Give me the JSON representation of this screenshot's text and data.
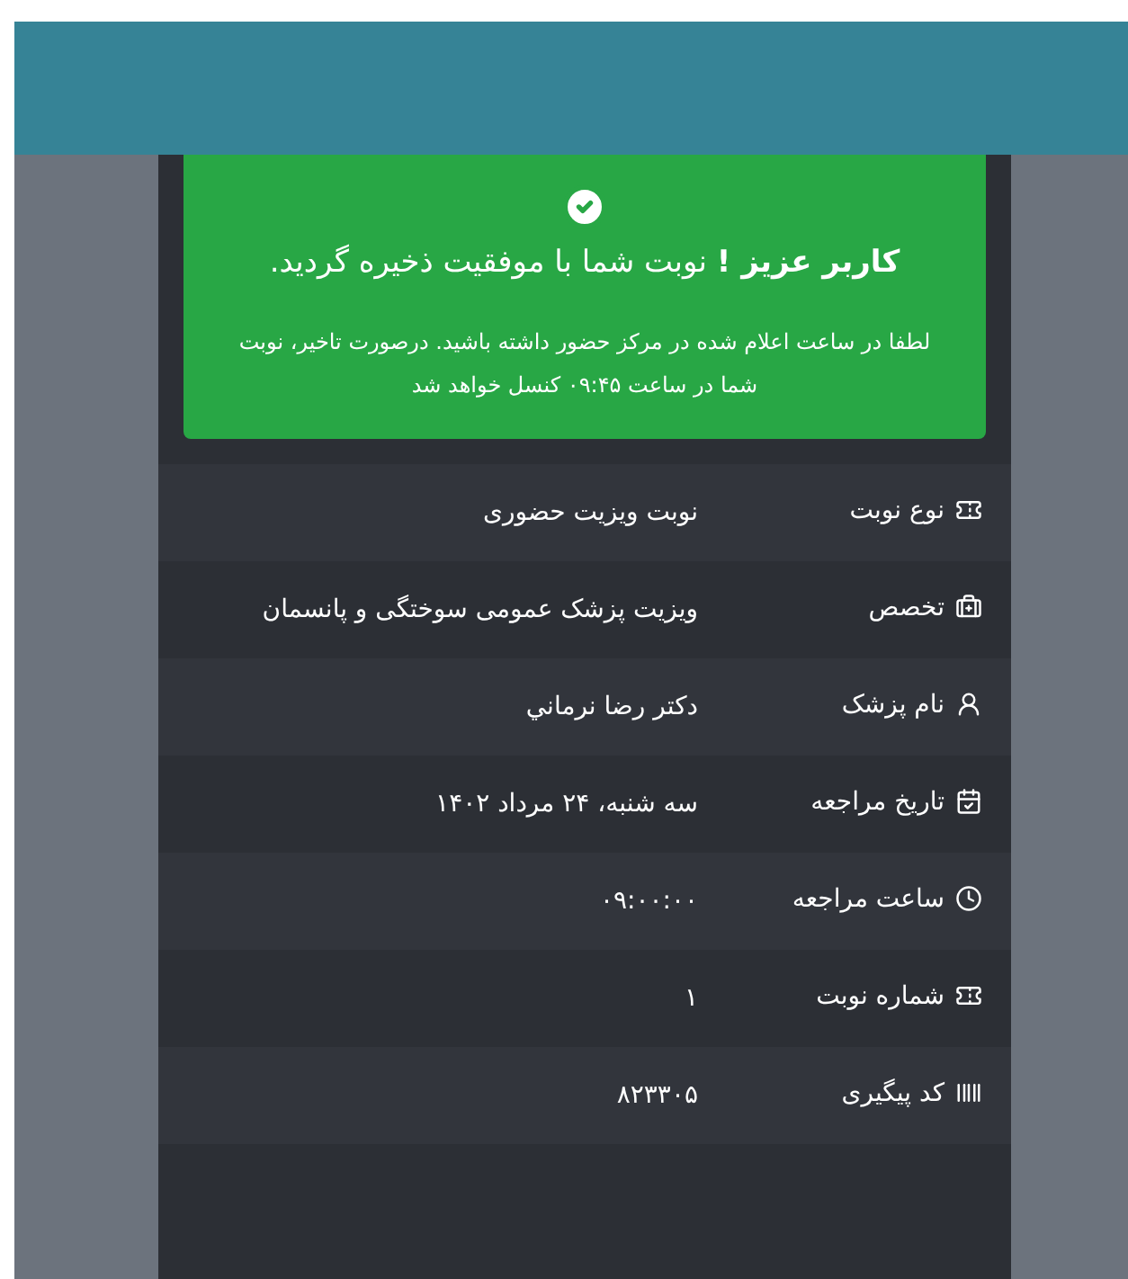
{
  "alert": {
    "title": "**کاربر عزیز !** نوبت شما با موفقیت ذخیره گردید.",
    "message": "لطفا در ساعت اعلام شده در مرکز حضور داشته باشید. درصورت تاخیر، نوبت شما در ساعت ۰۹:۴۵ کنسل خواهد شد"
  },
  "details": [
    {
      "kind": "ticket",
      "label": "نوع نوبت",
      "value": "نوبت ویزیت حضوری"
    },
    {
      "kind": "medkit",
      "label": "تخصص",
      "value": "ویزیت پزشک عمومی سوختگی و پانسمان"
    },
    {
      "kind": "doctor",
      "label": "نام پزشک",
      "value": "دکتر رضا نرماني"
    },
    {
      "kind": "calendar",
      "label": "تاریخ مراجعه",
      "value": "سه شنبه، ۲۴ مرداد ۱۴۰۲"
    },
    {
      "kind": "clock",
      "label": "ساعت مراجعه",
      "value": "۰۹:۰۰:۰۰"
    },
    {
      "kind": "ticket",
      "label": "شماره نوبت",
      "value": "۱"
    },
    {
      "kind": "barcode",
      "label": "کد پیگیری",
      "value": "۸۲۳۳۰۵"
    }
  ]
}
